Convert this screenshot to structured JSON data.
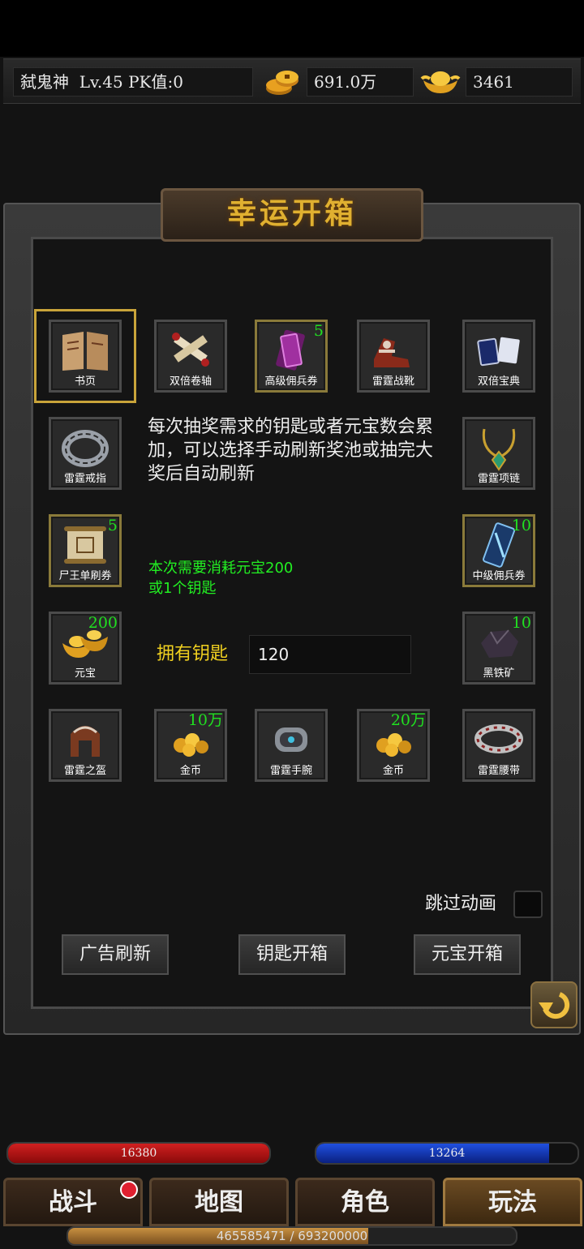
{
  "player": {
    "name": "弑鬼神",
    "level": "Lv.45",
    "pk": "PK值:0",
    "gold": "691.0万",
    "ingots": "3461"
  },
  "panel": {
    "title": "幸运开箱",
    "description": "每次抽奖需求的钥匙或者元宝数会累加，可以选择手动刷新奖池或抽完大奖后自动刷新",
    "cost_line1": "本次需要消耗元宝200",
    "cost_line2": "或1个钥匙",
    "keys_label": "拥有钥匙",
    "keys_value": "120",
    "skip_label": "跳过动画",
    "buttons": {
      "ad_refresh": "广告刷新",
      "key_open": "钥匙开箱",
      "ingot_open": "元宝开箱"
    }
  },
  "items": [
    {
      "name": "书页",
      "count": ""
    },
    {
      "name": "双倍卷轴",
      "count": ""
    },
    {
      "name": "高级佣兵券",
      "count": "5"
    },
    {
      "name": "雷霆战靴",
      "count": ""
    },
    {
      "name": "双倍宝典",
      "count": ""
    },
    {
      "name": "雷霆戒指",
      "count": ""
    },
    {
      "name": "雷霆项链",
      "count": ""
    },
    {
      "name": "尸王单刷券",
      "count": "5"
    },
    {
      "name": "中级佣兵券",
      "count": "10"
    },
    {
      "name": "元宝",
      "count": "200"
    },
    {
      "name": "黑铁矿",
      "count": "10"
    },
    {
      "name": "雷霆之盔",
      "count": ""
    },
    {
      "name": "金币",
      "count": "10万"
    },
    {
      "name": "雷霆手腕",
      "count": ""
    },
    {
      "name": "金币",
      "count": "20万"
    },
    {
      "name": "雷霆腰带",
      "count": ""
    }
  ],
  "bars": {
    "hp": "16380",
    "hp_fraction": 1.0,
    "mp": "13264",
    "mp_fraction": 0.89,
    "exp": "465585471 / 693200000",
    "exp_fraction": 0.67
  },
  "nav": {
    "battle": "战斗",
    "map": "地图",
    "character": "角色",
    "gameplay": "玩法"
  },
  "colors": {
    "title_gold": "#e0b030",
    "count_green": "#20e020",
    "cost_green": "#22ee22",
    "keys_yellow": "#f0d020"
  }
}
